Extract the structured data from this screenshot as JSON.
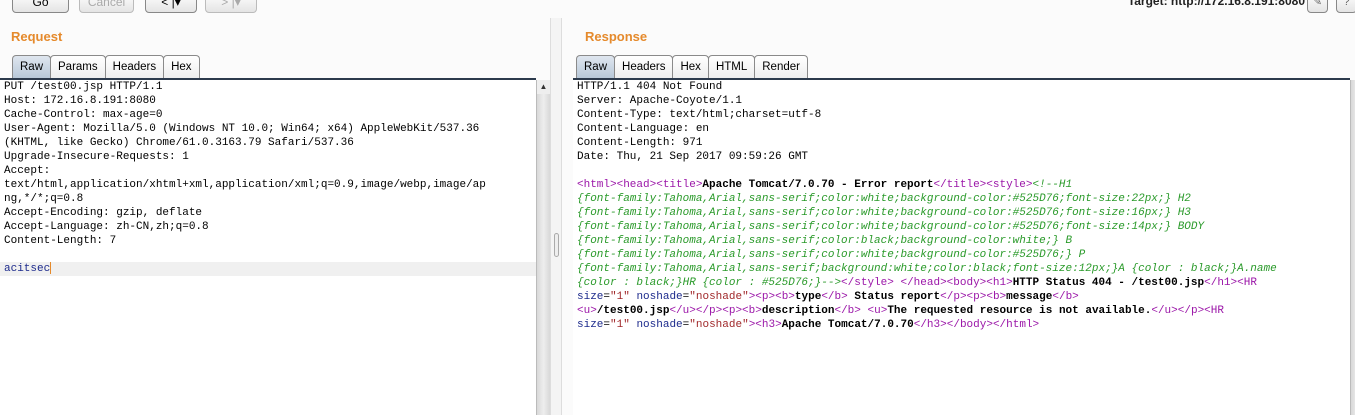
{
  "toolbar": {
    "go": "Go",
    "cancel": "Cancel",
    "back": "< |▾",
    "forward": "> |▾",
    "target": "Target: http://172.16.8.191:8080",
    "edit_icon": "pencil-icon",
    "help_icon": "help-icon"
  },
  "request": {
    "title": "Request",
    "tabs": [
      "Raw",
      "Params",
      "Headers",
      "Hex"
    ],
    "active_tab": "Raw",
    "lines": [
      "PUT /test00.jsp HTTP/1.1",
      "Host: 172.16.8.191:8080",
      "Cache-Control: max-age=0",
      "User-Agent: Mozilla/5.0 (Windows NT 10.0; Win64; x64) AppleWebKit/537.36",
      "(KHTML, like Gecko) Chrome/61.0.3163.79 Safari/537.36",
      "Upgrade-Insecure-Requests: 1",
      "Accept:",
      "text/html,application/xhtml+xml,application/xml;q=0.9,image/webp,image/ap",
      "ng,*/*;q=0.8",
      "Accept-Encoding: gzip, deflate",
      "Accept-Language: zh-CN,zh;q=0.8",
      "Content-Length: 7",
      "",
      "acitsec"
    ]
  },
  "response": {
    "title": "Response",
    "tabs": [
      "Raw",
      "Headers",
      "Hex",
      "HTML",
      "Render"
    ],
    "active_tab": "Raw",
    "headers": [
      "HTTP/1.1 404 Not Found",
      "Server: Apache-Coyote/1.1",
      "Content-Type: text/html;charset=utf-8",
      "Content-Language: en",
      "Content-Length: 971",
      "Date: Thu, 21 Sep 2017 09:59:26 GMT",
      ""
    ],
    "body": [
      [
        [
          "tag",
          "<html><head><title>"
        ],
        [
          "txt",
          "Apache Tomcat/7.0.70 - Error report"
        ],
        [
          "tag",
          "</title><style>"
        ],
        [
          "cmt",
          "<!--H1"
        ]
      ],
      [
        [
          "cmt",
          "{font-family:Tahoma,Arial,sans-serif;color:white;background-color:#525D76;font-size:22px;} H2"
        ]
      ],
      [
        [
          "cmt",
          "{font-family:Tahoma,Arial,sans-serif;color:white;background-color:#525D76;font-size:16px;} H3"
        ]
      ],
      [
        [
          "cmt",
          "{font-family:Tahoma,Arial,sans-serif;color:white;background-color:#525D76;font-size:14px;} BODY"
        ]
      ],
      [
        [
          "cmt",
          "{font-family:Tahoma,Arial,sans-serif;color:black;background-color:white;} B"
        ]
      ],
      [
        [
          "cmt",
          "{font-family:Tahoma,Arial,sans-serif;color:white;background-color:#525D76;} P"
        ]
      ],
      [
        [
          "cmt",
          "{font-family:Tahoma,Arial,sans-serif;background:white;color:black;font-size:12px;}A {color : black;}A.name"
        ]
      ],
      [
        [
          "cmt",
          "{color : black;}HR {color : #525D76;}-->"
        ],
        [
          "tag",
          "</style>"
        ],
        [
          "pl",
          " "
        ],
        [
          "tag",
          "</head><body><h1>"
        ],
        [
          "txt",
          "HTTP Status 404 - /test00.jsp"
        ],
        [
          "tag",
          "</h1><HR"
        ]
      ],
      [
        [
          "attr",
          "size"
        ],
        [
          "pl",
          "="
        ],
        [
          "val",
          "\"1\""
        ],
        [
          "pl",
          " "
        ],
        [
          "attr",
          "noshade"
        ],
        [
          "pl",
          "="
        ],
        [
          "val",
          "\"noshade\""
        ],
        [
          "tag",
          "><p><b>"
        ],
        [
          "txt",
          "type"
        ],
        [
          "tag",
          "</b>"
        ],
        [
          "txt",
          " Status report"
        ],
        [
          "tag",
          "</p><p><b>"
        ],
        [
          "txt",
          "message"
        ],
        [
          "tag",
          "</b>"
        ]
      ],
      [
        [
          "tag",
          "<u>"
        ],
        [
          "txt",
          "/test00.jsp"
        ],
        [
          "tag",
          "</u></p><p><b>"
        ],
        [
          "txt",
          "description"
        ],
        [
          "tag",
          "</b>"
        ],
        [
          "pl",
          " "
        ],
        [
          "tag",
          "<u>"
        ],
        [
          "txt",
          "The requested resource is not available."
        ],
        [
          "tag",
          "</u></p><HR"
        ]
      ],
      [
        [
          "attr",
          "size"
        ],
        [
          "pl",
          "="
        ],
        [
          "val",
          "\"1\""
        ],
        [
          "pl",
          " "
        ],
        [
          "attr",
          "noshade"
        ],
        [
          "pl",
          "="
        ],
        [
          "val",
          "\"noshade\""
        ],
        [
          "tag",
          "><h3>"
        ],
        [
          "txt",
          "Apache Tomcat/7.0.70"
        ],
        [
          "tag",
          "</h3></body></html>"
        ]
      ]
    ]
  }
}
